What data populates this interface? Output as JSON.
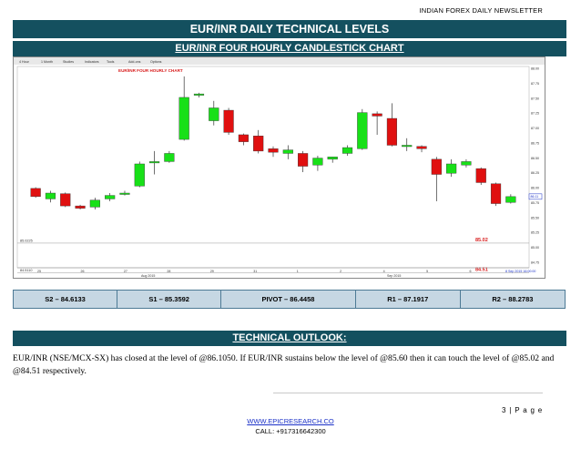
{
  "newsletter_title": "INDIAN FOREX DAILY NEWSLETTER",
  "report_title": "EUR/INR DAILY TECHNICAL LEVELS",
  "chart_section_title": "EUR/INR FOUR HOURLY CANDLESTICK CHART",
  "chart": {
    "label": "EUR/INR FOUR HOURLY CHART",
    "toolbar": [
      "4 Hour",
      "1 Month",
      "Studies",
      "Indicators",
      "Tools",
      "Add-ons",
      "Options"
    ],
    "price_levels": [
      {
        "label": "85.0225",
        "value": 85.0225
      },
      {
        "label": "84.5110",
        "value": 84.511
      }
    ],
    "annotations": [
      "85.02",
      "84.51"
    ],
    "y_axis_ticks": [
      "88.00",
      "87.75",
      "87.50",
      "87.25",
      "87.00",
      "86.75",
      "86.50",
      "86.25",
      "86.00",
      "85.75",
      "85.50",
      "85.25",
      "85.00",
      "84.75"
    ],
    "x_axis_ticks": [
      "25",
      "26",
      "27",
      "28",
      "29",
      "31",
      "1",
      "2",
      "4",
      "5",
      "6",
      "8 Sep 2015 16:00:00"
    ],
    "x_axis_months": [
      "Aug 2015",
      "Sep 2015"
    ],
    "last_price_label": "86.11",
    "colors": {
      "up": "#18e018",
      "down": "#e01010",
      "annotation": "#d81e1e"
    }
  },
  "chart_data": {
    "type": "candlestick",
    "ylim": [
      84.6,
      88.05
    ],
    "candles": [
      {
        "open": 85.96,
        "close": 85.82,
        "high": 85.98,
        "low": 85.8
      },
      {
        "open": 85.78,
        "close": 85.88,
        "high": 85.92,
        "low": 85.72
      },
      {
        "open": 85.87,
        "close": 85.66,
        "high": 85.89,
        "low": 85.64
      },
      {
        "open": 85.66,
        "close": 85.62,
        "high": 85.68,
        "low": 85.6
      },
      {
        "open": 85.64,
        "close": 85.76,
        "high": 85.8,
        "low": 85.6
      },
      {
        "open": 85.78,
        "close": 85.84,
        "high": 85.88,
        "low": 85.74
      },
      {
        "open": 85.86,
        "close": 85.88,
        "high": 85.92,
        "low": 85.84
      },
      {
        "open": 86.0,
        "close": 86.38,
        "high": 86.42,
        "low": 85.98
      },
      {
        "open": 86.4,
        "close": 86.42,
        "high": 86.6,
        "low": 86.2
      },
      {
        "open": 86.42,
        "close": 86.56,
        "high": 86.6,
        "low": 86.4
      },
      {
        "open": 86.8,
        "close": 87.52,
        "high": 87.88,
        "low": 86.78
      },
      {
        "open": 87.56,
        "close": 87.58,
        "high": 87.6,
        "low": 87.52
      },
      {
        "open": 87.12,
        "close": 87.34,
        "high": 87.46,
        "low": 87.04
      },
      {
        "open": 87.3,
        "close": 86.92,
        "high": 87.34,
        "low": 86.88
      },
      {
        "open": 86.88,
        "close": 86.76,
        "high": 86.9,
        "low": 86.7
      },
      {
        "open": 86.86,
        "close": 86.6,
        "high": 86.96,
        "low": 86.56
      },
      {
        "open": 86.64,
        "close": 86.58,
        "high": 86.68,
        "low": 86.5
      },
      {
        "open": 86.56,
        "close": 86.62,
        "high": 86.7,
        "low": 86.46
      },
      {
        "open": 86.56,
        "close": 86.34,
        "high": 86.6,
        "low": 86.24
      },
      {
        "open": 86.36,
        "close": 86.48,
        "high": 86.52,
        "low": 86.26
      },
      {
        "open": 86.46,
        "close": 86.5,
        "high": 86.5,
        "low": 86.4
      },
      {
        "open": 86.56,
        "close": 86.66,
        "high": 86.7,
        "low": 86.52
      },
      {
        "open": 86.64,
        "close": 87.26,
        "high": 87.32,
        "low": 86.62
      },
      {
        "open": 87.24,
        "close": 87.2,
        "high": 87.28,
        "low": 86.88
      },
      {
        "open": 87.16,
        "close": 86.7,
        "high": 87.42,
        "low": 86.68
      },
      {
        "open": 86.7,
        "close": 86.7,
        "high": 86.82,
        "low": 86.6
      },
      {
        "open": 86.68,
        "close": 86.64,
        "high": 86.7,
        "low": 86.58
      },
      {
        "open": 86.46,
        "close": 86.2,
        "high": 86.5,
        "low": 85.74
      },
      {
        "open": 86.22,
        "close": 86.38,
        "high": 86.46,
        "low": 86.16
      },
      {
        "open": 86.36,
        "close": 86.42,
        "high": 86.46,
        "low": 86.32
      },
      {
        "open": 86.3,
        "close": 86.06,
        "high": 86.32,
        "low": 86.02
      },
      {
        "open": 86.04,
        "close": 85.7,
        "high": 86.06,
        "low": 85.66
      },
      {
        "open": 85.72,
        "close": 85.82,
        "high": 85.86,
        "low": 85.7
      }
    ]
  },
  "levels": [
    {
      "text": "S2 – 84.6133"
    },
    {
      "text": "S1 – 85.3592"
    },
    {
      "text": "PIVOT – 86.4458"
    },
    {
      "text": "R1 – 87.1917"
    },
    {
      "text": "R2 – 88.2783"
    }
  ],
  "outlook_title": "TECHNICAL OUTLOOK:",
  "outlook_text": "EUR/INR (NSE/MCX-SX) has closed at the level of @86.1050.  If EUR/INR sustains below the level of @85.60 then it can touch the level of @85.02 and @84.51 respectively.",
  "footer": {
    "page_number": "3 | P a g e",
    "website": "WWW.EPICRESEARCH.CO",
    "call": "CALL: +917316642300"
  }
}
